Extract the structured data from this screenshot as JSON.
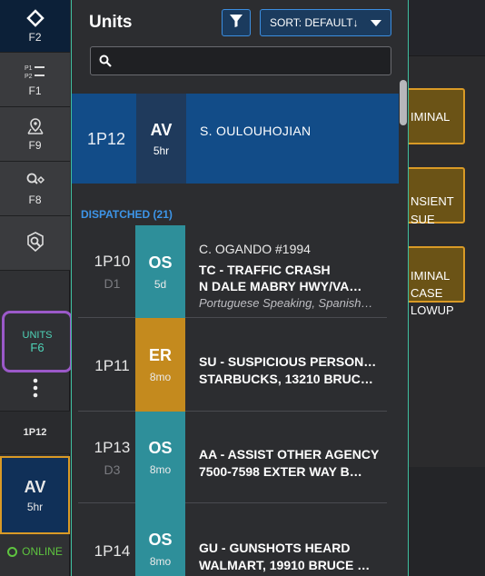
{
  "rail": {
    "top_label": "F2",
    "f1_label": "F1",
    "f9_label": "F9",
    "f8_label": "F8",
    "units_label": "UNITS",
    "units_key": "F6",
    "unit_id": "1P12",
    "current_status": "AV",
    "current_duration": "5hr",
    "online_label": "ONLINE"
  },
  "background_cards": [
    "IMINAL",
    "NSIENT\nSUE",
    "IMINAL\nCASE\nLOWUP"
  ],
  "panel": {
    "title": "Units",
    "sort_label": "SORT: DEFAULT↓",
    "search_placeholder": "",
    "selected": {
      "id": "1P12",
      "status": "AV",
      "duration": "5hr",
      "name": "S. OULOUHOJIAN"
    },
    "section_label": "DISPATCHED (21)",
    "rows": [
      {
        "id": "1P10",
        "sub": "D1",
        "status": "OS",
        "duration": "5d",
        "color": "#2e8f9a",
        "line1": "C. OGANDO #1994",
        "line2": "TC - TRAFFIC CRASH",
        "line3": "N DALE MABRY HWY/VA…",
        "line4": "Portuguese Speaking, Spanish…"
      },
      {
        "id": "1P11",
        "sub": "",
        "status": "ER",
        "duration": "8mo",
        "color": "#c48a1e",
        "line1": "",
        "line2": "SU - SUSPICIOUS PERSON…",
        "line3": "STARBUCKS, 13210 BRUC…",
        "line4": ""
      },
      {
        "id": "1P13",
        "sub": "D3",
        "status": "OS",
        "duration": "8mo",
        "color": "#2e8f9a",
        "line1": "",
        "line2": "AA - ASSIST OTHER AGENCY",
        "line3": "7500-7598 EXTER WAY B…",
        "line4": ""
      },
      {
        "id": "1P14",
        "sub": "",
        "status": "OS",
        "duration": "8mo",
        "color": "#2e8f9a",
        "line1": "",
        "line2": "GU - GUNSHOTS HEARD",
        "line3": "WALMART, 19910 BRUCE …",
        "line4": ""
      }
    ]
  },
  "colors": {
    "accent": "#3fbfa0",
    "selected_row": "#124c88",
    "status_os": "#2e8f9a",
    "status_er": "#c48a1e",
    "highlight": "#9b59c9",
    "online": "#5ec43f"
  }
}
